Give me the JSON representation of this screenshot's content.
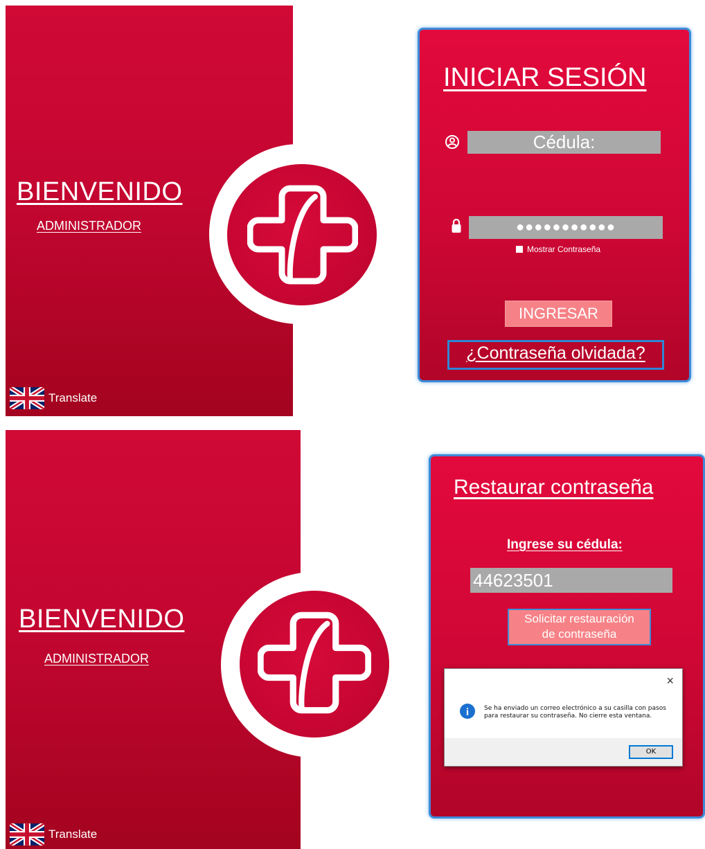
{
  "login_screen": {
    "welcome": "BIENVENIDO",
    "role": "ADMINISTRADOR",
    "translate": "Translate",
    "title": "INICIAR SESIÓN",
    "cedula_placeholder": "Cédula:",
    "password_mask": "●●●●●●●●●●●",
    "show_password": "Mostrar Contraseña",
    "login_button": "INGRESAR",
    "forgot_link": "¿Contraseña olvidada?"
  },
  "restore_screen": {
    "welcome": "BIENVENIDO",
    "role": "ADMINISTRADOR",
    "translate": "Translate",
    "title": "Restaurar contraseña",
    "cedula_label": "Ingrese su cédula:",
    "cedula_value": "44623501",
    "request_button_line1": "Solicitar restauración",
    "request_button_line2": "de contraseña",
    "dialog": {
      "close": "×",
      "message_line1": "Se ha enviado un correo electrónico a su casilla con pasos",
      "message_line2": "para restaurar su contraseña. No cierre esta ventana.",
      "ok": "OK",
      "info_icon_glyph": "i"
    }
  },
  "colors": {
    "brand_red": "#c80633",
    "field_gray": "#a9a9a9",
    "button_salmon": "#f68287",
    "focus_blue": "#2e87d3"
  },
  "icons": {
    "flag": "uk-flag-icon",
    "user": "user-circle-icon",
    "lock": "lock-icon",
    "info": "info-icon",
    "logo": "medical-cross-logo"
  }
}
